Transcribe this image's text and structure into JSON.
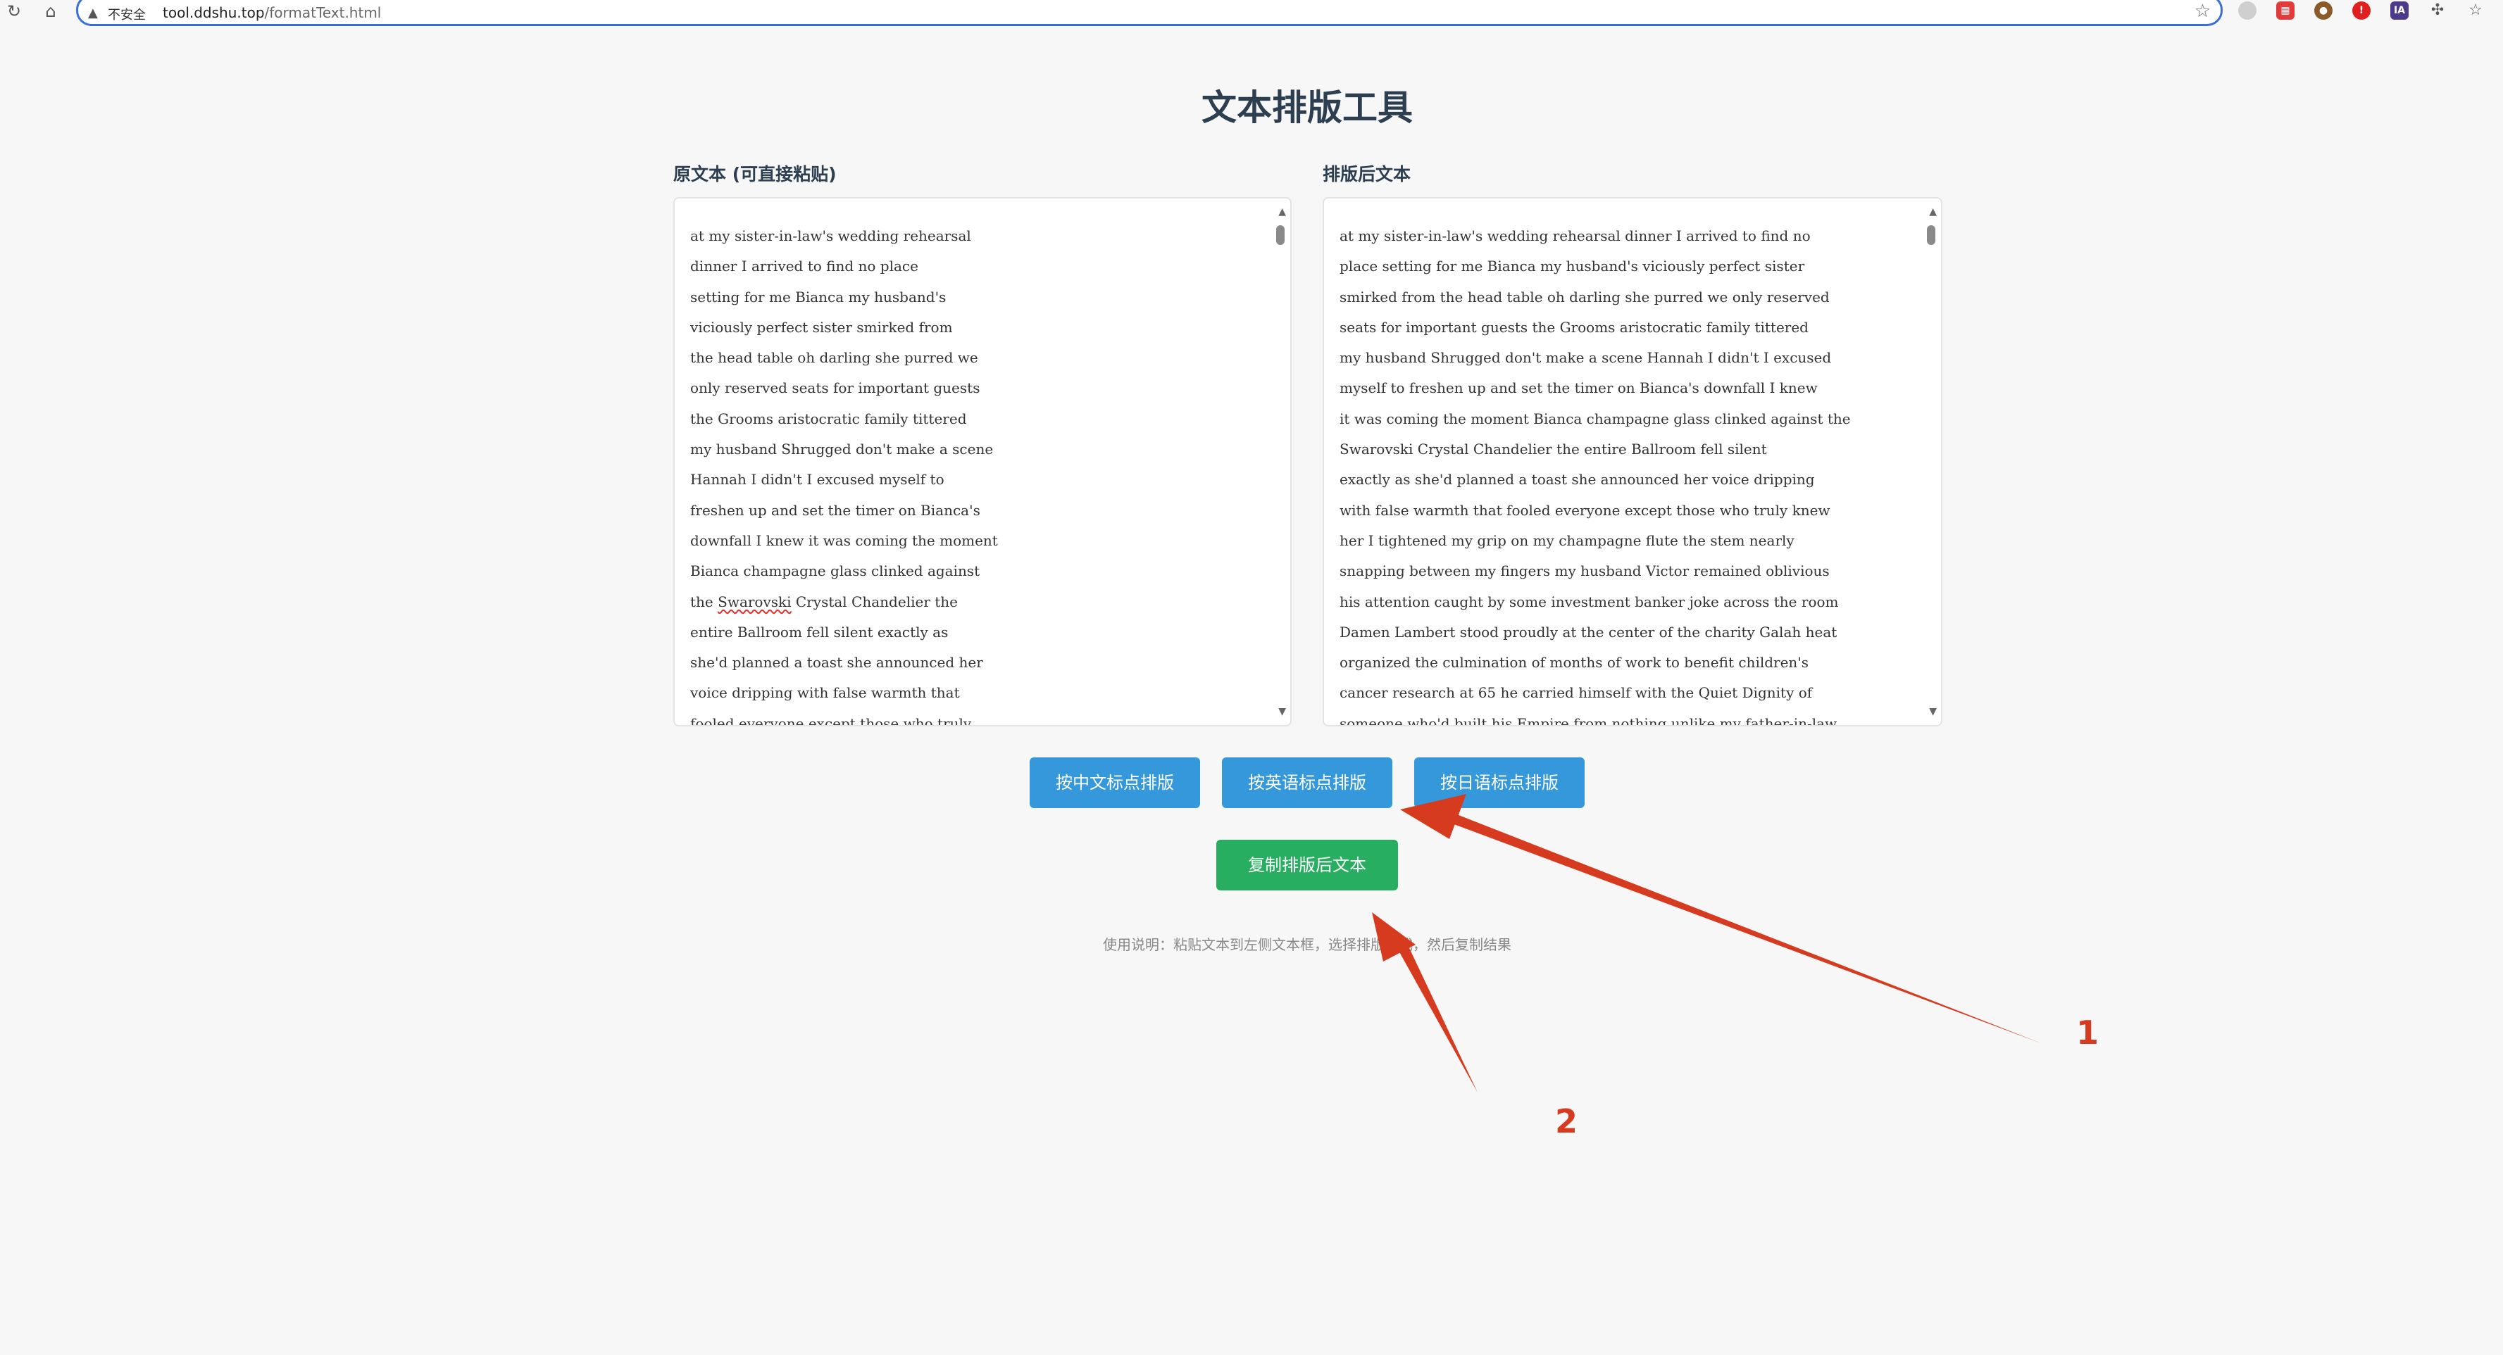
{
  "browser": {
    "insecure_label": "不安全",
    "url_host": "tool.ddshu.top",
    "url_path": "/formatText.html",
    "icons": [
      "reload-icon",
      "home-icon",
      "warning-icon",
      "star-icon"
    ]
  },
  "page": {
    "title": "文本排版工具",
    "left_label": "原文本 (可直接粘贴)",
    "right_label": "排版后文本",
    "left_lines": [
      "at my sister-in-law's wedding rehearsal",
      "dinner I arrived to find no place",
      "setting for me Bianca my husband's",
      "viciously perfect sister smirked from",
      "the head table oh darling she purred we",
      "only reserved seats for important guests",
      "the Grooms aristocratic family tittered",
      "my husband Shrugged don't make a scene",
      "Hannah I didn't I excused myself to",
      "freshen up and set the timer on Bianca's",
      "downfall I knew it was coming the moment",
      "Bianca champagne glass clinked against",
      "the Swarovski Crystal Chandelier the",
      "entire Ballroom fell silent exactly as",
      "she'd planned a toast she announced her",
      "voice dripping with false warmth that",
      "fooled everyone except those who truly"
    ],
    "right_lines": [
      "at my sister-in-law's wedding rehearsal dinner I arrived to find no",
      "place setting for me Bianca my husband's viciously perfect sister",
      "smirked from the head table oh darling she purred we only reserved",
      "seats for important guests the Grooms aristocratic family tittered",
      "my husband Shrugged don't make a scene Hannah I didn't I excused",
      "myself to freshen up and set the timer on Bianca's downfall I knew",
      "it was coming the moment Bianca champagne glass clinked against the",
      "Swarovski Crystal Chandelier the entire Ballroom fell silent",
      "exactly as she'd planned a toast she announced her voice dripping",
      "with false warmth that fooled everyone except those who truly knew",
      "her I tightened my grip on my champagne flute the stem nearly",
      "snapping between my fingers my husband Victor remained oblivious",
      "his attention caught by some investment banker joke across the room",
      "Damen Lambert stood proudly at the center of the charity Galah heat",
      "organized the culmination of months of work to benefit children's",
      "cancer research at 65 he carried himself with the Quiet Dignity of",
      "someone who'd built his Empire from nothing unlike my father-in-law"
    ],
    "buttons": {
      "chinese": "按中文标点排版",
      "english": "按英语标点排版",
      "japanese": "按日语标点排版",
      "copy": "复制排版后文本"
    },
    "usage": "使用说明：粘贴文本到左侧文本框，选择排版方式，然后复制结果"
  },
  "annotations": {
    "label_1": "1",
    "label_2": "2",
    "color": "#d63b1f"
  }
}
